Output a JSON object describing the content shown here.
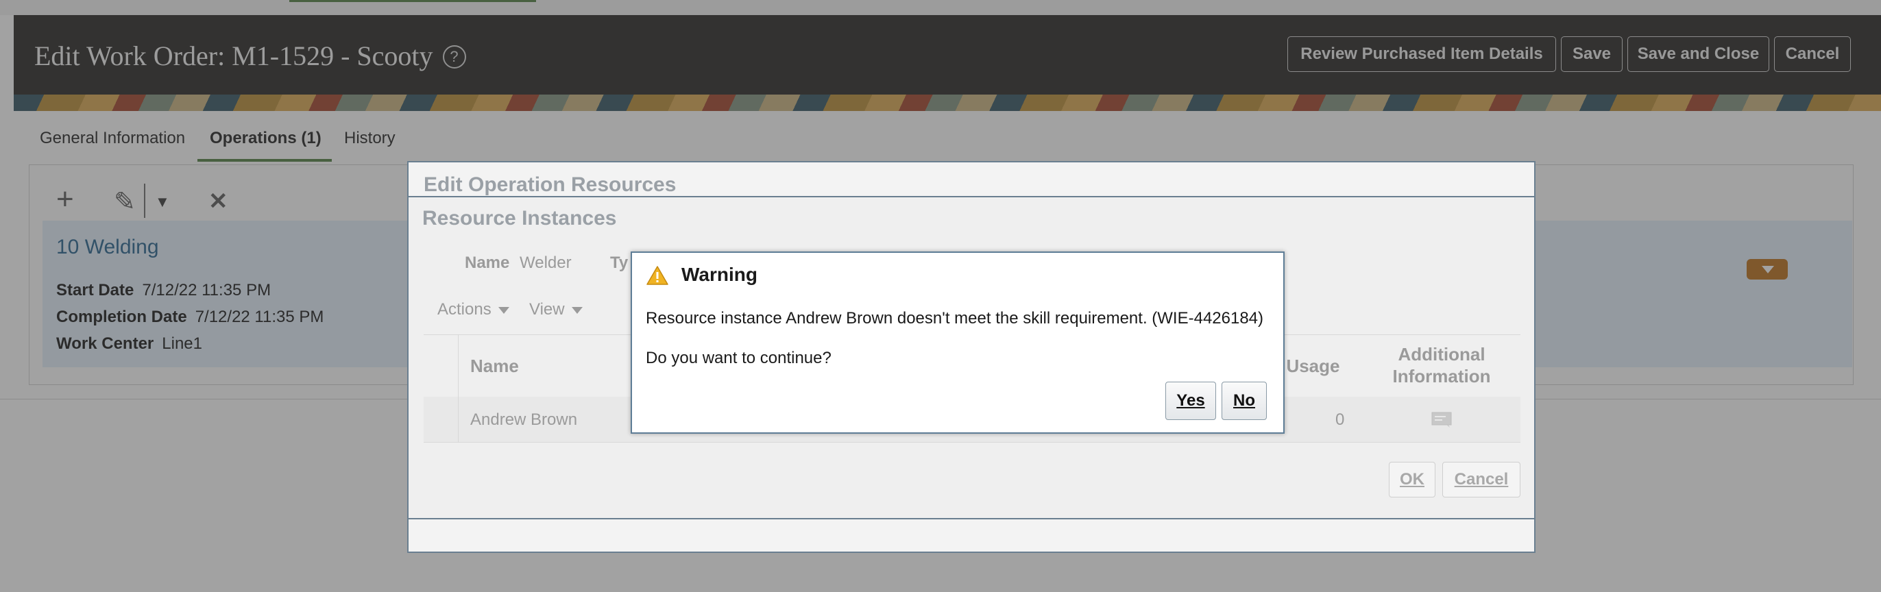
{
  "page": {
    "title": "Edit Work Order: M1-1529 - Scooty",
    "help_glyph": "?",
    "buttons": {
      "review": "Review Purchased Item Details",
      "save": "Save",
      "save_close": "Save and Close",
      "cancel": "Cancel"
    }
  },
  "tabs": [
    {
      "label": "General Information"
    },
    {
      "label": "Operations (1)"
    },
    {
      "label": "History"
    }
  ],
  "toolbar": {
    "add_glyph": "+",
    "edit_glyph": "✎",
    "dropdown_glyph": "▼",
    "delete_glyph": "✕"
  },
  "operation": {
    "name": "10 Welding",
    "start_label": "Start Date",
    "start_value": "7/12/22 11:35 PM",
    "completion_label": "Completion Date",
    "completion_value": "7/12/22 11:35 PM",
    "workcenter_label": "Work Center",
    "workcenter_value": "Line1"
  },
  "edit_resources_dialog": {
    "title": "Edit Operation Resources"
  },
  "resource_instances_dialog": {
    "title": "Resource Instances",
    "name_label": "Name",
    "name_value": "Welder",
    "type_label_partial": "Ty",
    "actions_label": "Actions",
    "view_label": "View",
    "columns": {
      "name": "Name",
      "usage": "l Usage",
      "additional_line1": "Additional",
      "additional_line2": "Information"
    },
    "row": {
      "name": "Andrew Brown",
      "usage": "0"
    },
    "ok_label": "OK",
    "cancel_label": "Cancel"
  },
  "warning_dialog": {
    "title": "Warning",
    "message": "Resource instance Andrew Brown doesn't meet the skill requirement. (WIE-4426184)",
    "question": "Do you want to continue?",
    "yes_label": "Yes",
    "no_label": "No"
  }
}
